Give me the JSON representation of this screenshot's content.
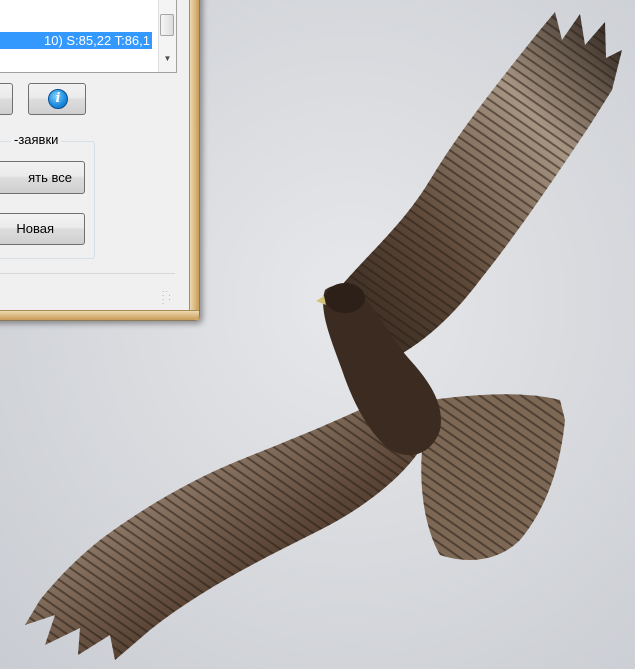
{
  "background": {
    "description_icon": "hawk-in-flight-photo",
    "sky_color": "#d9dbdf",
    "bird_color": "#3a2c22"
  },
  "window": {
    "list": {
      "selected_item": "10) S:85,22 T:86,1"
    },
    "buttons": {
      "info_icon_glyph": "i"
    },
    "group": {
      "title": "-заявки",
      "cancel_all_label": "ять все",
      "new_label": "Новая"
    },
    "accent_color": "#3399ff"
  }
}
